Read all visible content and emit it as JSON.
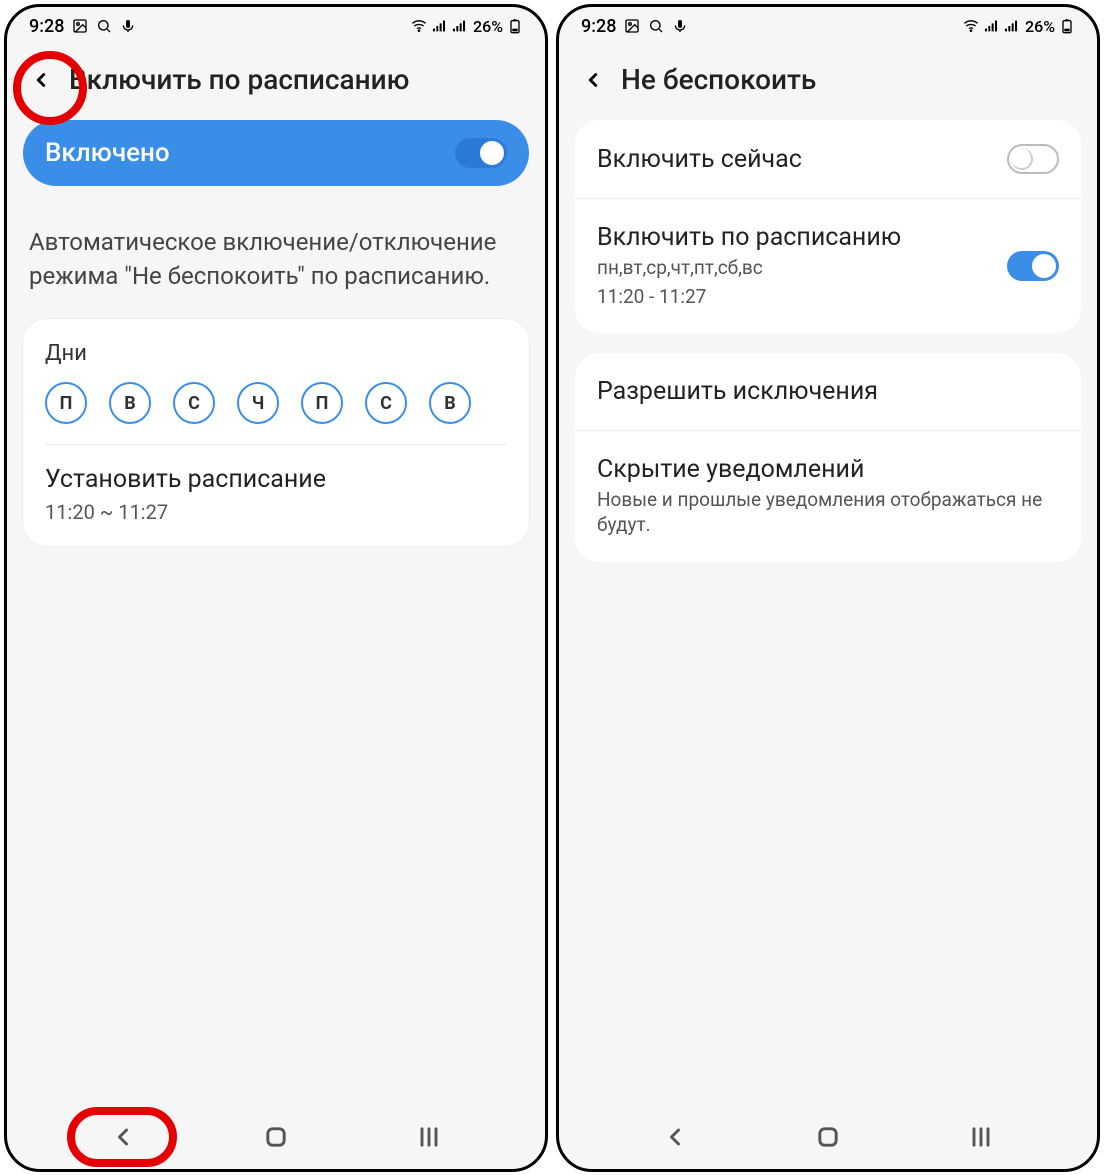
{
  "status": {
    "time": "9:28",
    "battery_pct": "26%"
  },
  "left": {
    "title": "Включить по расписанию",
    "enabled_label": "Включено",
    "description": "Автоматическое включение/отключение режима \"Не беспокоить\" по расписанию.",
    "days_label": "Дни",
    "days": [
      "П",
      "В",
      "С",
      "Ч",
      "П",
      "С",
      "В"
    ],
    "schedule_label": "Установить расписание",
    "schedule_value": "11:20 ~ 11:27"
  },
  "right": {
    "title": "Не беспокоить",
    "rows": {
      "now": {
        "title": "Включить сейчас"
      },
      "schedule": {
        "title": "Включить по расписанию",
        "sub1": "пн,вт,ср,чт,пт,сб,вс",
        "sub2": "11:20 - 11:27"
      },
      "exceptions": {
        "title": "Разрешить исключения"
      },
      "hide": {
        "title": "Скрытие уведомлений",
        "sub": "Новые и прошлые уведомления отображаться не будут."
      }
    }
  }
}
